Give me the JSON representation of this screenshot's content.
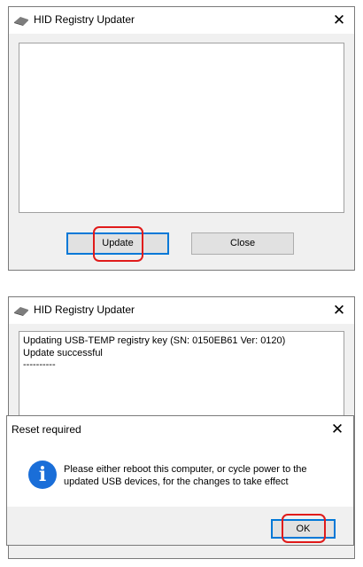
{
  "window1": {
    "title": "HID Registry Updater",
    "close_glyph": "✕",
    "update_label": "Update",
    "close_label": "Close"
  },
  "window2": {
    "title": "HID Registry Updater",
    "close_glyph": "✕",
    "log_lines": [
      "Updating USB-TEMP registry key (SN: 0150EB61 Ver: 0120)",
      "Update successful",
      "----------"
    ]
  },
  "dialog": {
    "title": "Reset required",
    "close_glyph": "✕",
    "icon_glyph": "i",
    "message_lines": [
      "Please either reboot this computer, or cycle power to the",
      "updated USB devices, for the changes to take effect"
    ],
    "ok_label": "OK"
  },
  "icons": {
    "app": "usb-device-icon",
    "info": "info-icon"
  },
  "colors": {
    "highlight_ring": "#e01b1b",
    "default_button_border": "#0078d7",
    "info_icon": "#1a6ed8"
  }
}
